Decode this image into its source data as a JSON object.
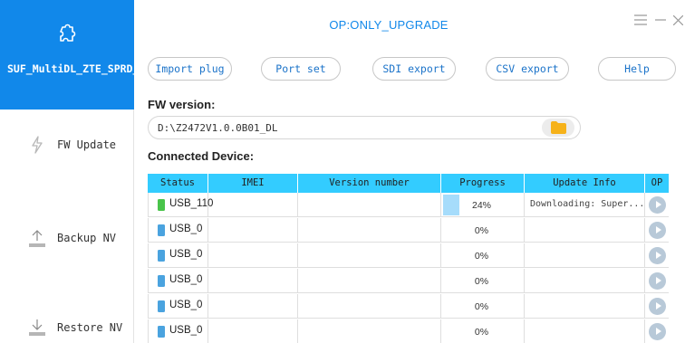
{
  "window": {
    "title": "OP:ONLY_UPGRADE",
    "menu_icon": "menu-icon",
    "minimize_icon": "minimize-icon",
    "close_icon": "close-icon"
  },
  "sidebar": {
    "app_name": "SUF_MultiDL_ZTE_SPRD_OL...",
    "logo_icon": "puzzle-icon",
    "items": [
      {
        "label": "FW Update",
        "icon": "lightning-icon"
      },
      {
        "label": "Backup NV",
        "icon": "upload-icon"
      },
      {
        "label": "Restore NV",
        "icon": "download-icon"
      }
    ]
  },
  "toolbar": {
    "import_plug": "Import plug",
    "port_set": "Port set",
    "sdi_export": "SDI export",
    "csv_export": "CSV export",
    "help": "Help"
  },
  "fw": {
    "label": "FW version:",
    "path": "D:\\Z2472V1.0.0B01_DL",
    "folder_icon": "folder-icon"
  },
  "devices": {
    "label": "Connected Device:",
    "columns": [
      "Status",
      "IMEI",
      "Version number",
      "Progress",
      "Update Info",
      "OP"
    ],
    "rows": [
      {
        "status": "USB_110",
        "imei": "",
        "version": "",
        "progress": "24%",
        "progress_fraction": 0.24,
        "info": "Downloading: Super...",
        "status_color": "#49c44a"
      },
      {
        "status": "USB_0",
        "imei": "",
        "version": "",
        "progress": "0%",
        "progress_fraction": 0,
        "info": "",
        "status_color": "#4aa3df"
      },
      {
        "status": "USB_0",
        "imei": "",
        "version": "",
        "progress": "0%",
        "progress_fraction": 0,
        "info": "",
        "status_color": "#4aa3df"
      },
      {
        "status": "USB_0",
        "imei": "",
        "version": "",
        "progress": "0%",
        "progress_fraction": 0,
        "info": "",
        "status_color": "#4aa3df"
      },
      {
        "status": "USB_0",
        "imei": "",
        "version": "",
        "progress": "0%",
        "progress_fraction": 0,
        "info": "",
        "status_color": "#4aa3df"
      },
      {
        "status": "USB_0",
        "imei": "",
        "version": "",
        "progress": "0%",
        "progress_fraction": 0,
        "info": "",
        "status_color": "#4aa3df"
      }
    ]
  },
  "colors": {
    "accent": "#1188ea",
    "table_header": "#33ccff",
    "progress_fill": "#a6dcfb"
  }
}
